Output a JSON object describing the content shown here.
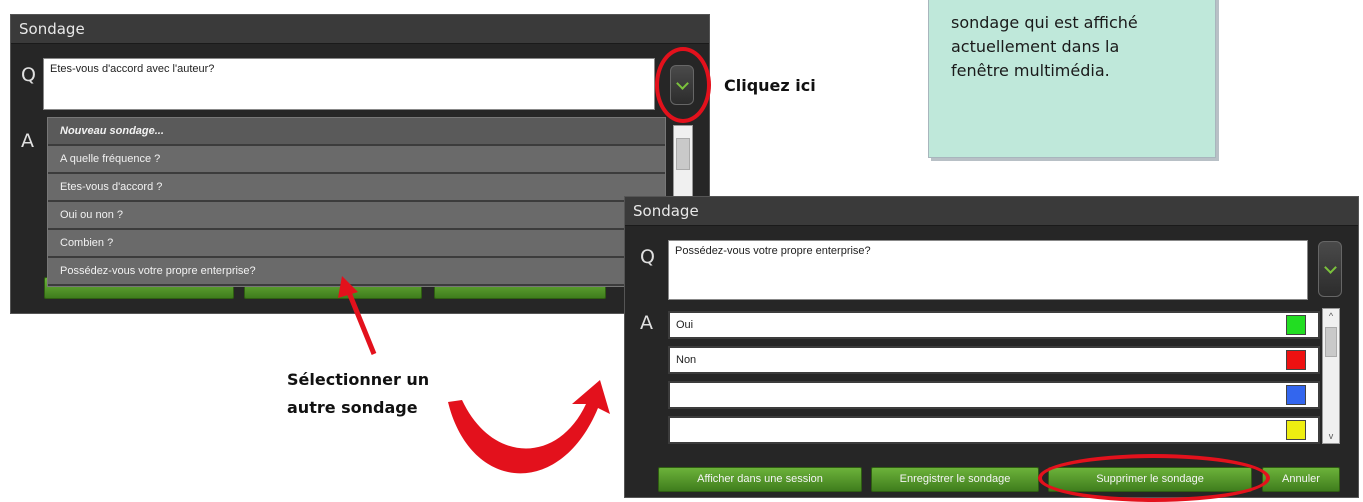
{
  "note": {
    "lines": [
      "sondage qui est affiché",
      "actuellement dans la",
      "fenêtre multimédia."
    ]
  },
  "back_window": {
    "title": "Sondage",
    "q_label": "Q",
    "a_label": "A",
    "question": "Etes-vous d'accord avec l'auteur?",
    "dropdown_items": [
      "Nouveau sondage...",
      "A quelle fréquence ?",
      "Etes-vous d'accord ?",
      "Oui ou non ?",
      "Combien ?",
      "Possédez-vous votre propre enterprise?"
    ]
  },
  "front_window": {
    "title": "Sondage",
    "q_label": "Q",
    "a_label": "A",
    "question": "Possédez-vous votre propre enterprise?",
    "answers": [
      {
        "text": "Oui",
        "color": "#22dd22"
      },
      {
        "text": "Non",
        "color": "#ee1111"
      },
      {
        "text": "",
        "color": "#3366ee"
      },
      {
        "text": "",
        "color": "#eeee11"
      }
    ],
    "buttons": {
      "show": "Afficher dans une session",
      "save": "Enregistrer le sondage",
      "delete": "Supprimer le sondage",
      "cancel": "Annuler"
    }
  },
  "annotations": {
    "click_here": "Cliquez ici",
    "select_line1": "Sélectionner un",
    "select_line2": "autre sondage"
  },
  "colors": {
    "annotation_red": "#e3111c",
    "button_green": "#4f9a27",
    "note_bg": "#bfe8da"
  }
}
